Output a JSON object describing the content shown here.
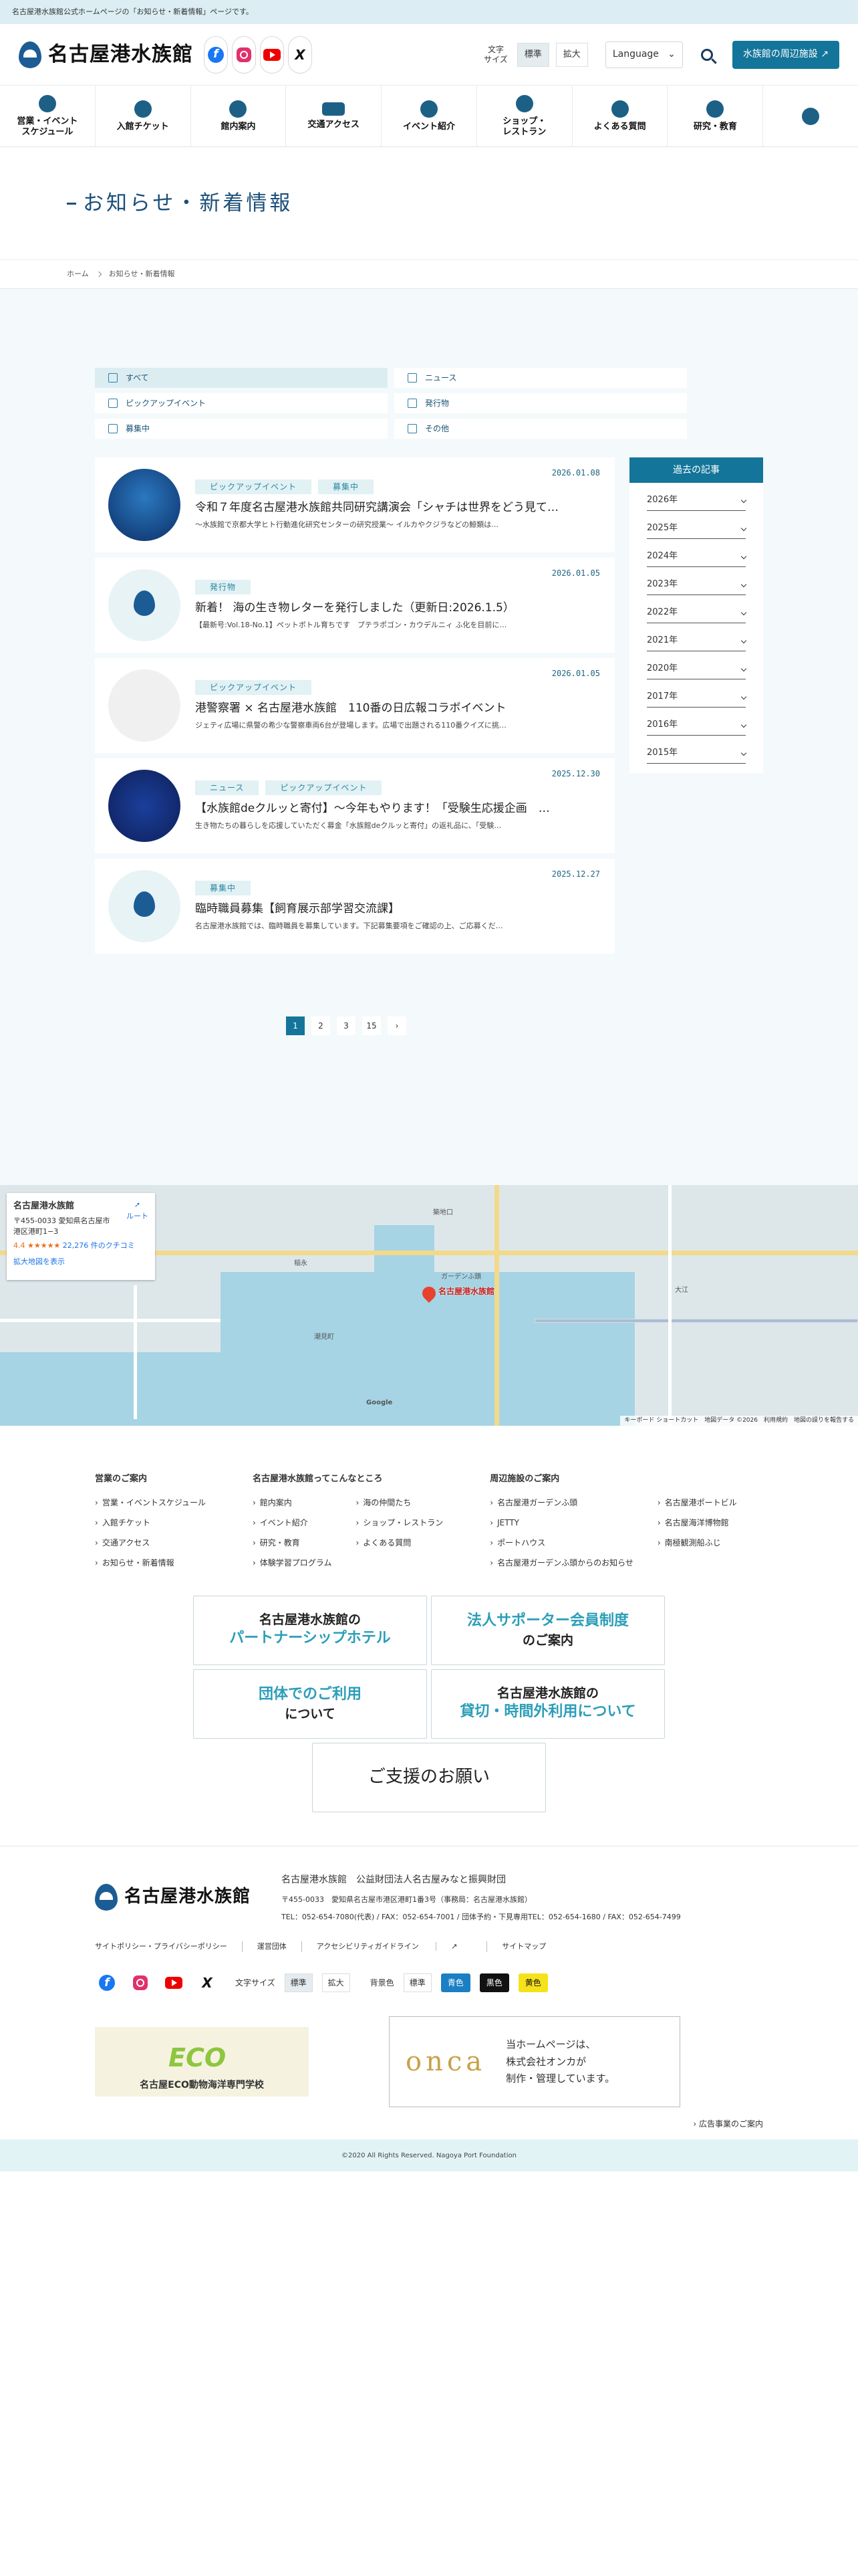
{
  "topbar": {
    "text": "名古屋港水族館公式ホームページの「お知らせ・新着情報」ページです。"
  },
  "header": {
    "logo_text": "名古屋港水族館",
    "font_size_label": "文字\nサイズ",
    "font_size_options": [
      "標準",
      "拡大"
    ],
    "language_label": "Language",
    "nearby_button": "水族館の周辺施設"
  },
  "gnav": [
    {
      "label": "営業・イベント\nスケジュール",
      "icon": "clock-icon"
    },
    {
      "label": "入館チケット",
      "icon": "ticket-icon"
    },
    {
      "label": "館内案内",
      "icon": "map-search-icon"
    },
    {
      "label": "交通アクセス",
      "icon": "bus-icon"
    },
    {
      "label": "イベント紹介",
      "icon": "flag-icon"
    },
    {
      "label": "ショップ・\nレストラン",
      "icon": "shop-icon"
    },
    {
      "label": "よくある質問",
      "icon": "question-icon"
    },
    {
      "label": "研究・教育",
      "icon": "lightbulb-icon"
    },
    {
      "label": "",
      "icon": "gear-icon"
    }
  ],
  "page": {
    "title": "お知らせ・新着情報"
  },
  "breadcrumb": [
    "ホーム",
    "お知らせ・新着情報"
  ],
  "filters": [
    {
      "label": "すべて",
      "icon": "grid-icon"
    },
    {
      "label": "ニュース",
      "icon": "document-icon"
    },
    {
      "label": "ピックアップイベント",
      "icon": "calendar-icon"
    },
    {
      "label": "発行物",
      "icon": "book-icon"
    },
    {
      "label": "募集中",
      "icon": "megaphone-icon"
    },
    {
      "label": "その他",
      "icon": "info-icon"
    }
  ],
  "news": [
    {
      "date": "2026.01.08",
      "tags": [
        "ピックアップイベント",
        "募集中"
      ],
      "title": "令和７年度名古屋港水族館共同研究講演会「シャチは世界をどう見て…",
      "excerpt": "～水族館で京都大学ヒト行動進化研究センターの研究授業～ イルカやクジラなどの鯨類は…"
    },
    {
      "date": "2026.01.05",
      "tags": [
        "発行物"
      ],
      "title": "新着！ 海の生き物レターを発行しました（更新日:2026.1.5）",
      "excerpt": "【最新号:Vol.18-No.1】ペットボトル育ちです　プテラポゴン・カウデルニィ ふ化を目前に…"
    },
    {
      "date": "2026.01.05",
      "tags": [
        "ピックアップイベント"
      ],
      "title": "港警察署 × 名古屋港水族館　110番の日広報コラボイベント",
      "excerpt": "ジェティ広場に県警の希少な警察車両6台が登場します。広場で出題される110番クイズに挑…"
    },
    {
      "date": "2025.12.30",
      "tags": [
        "ニュース",
        "ピックアップイベント"
      ],
      "title": "【水族館deクルッと寄付】～今年もやります！「受験生応援企画　…",
      "excerpt": "生き物たちの暮らしを応援していただく募金「水族館deクルッと寄付」の返礼品に、「受験…"
    },
    {
      "date": "2025.12.27",
      "tags": [
        "募集中"
      ],
      "title": "臨時職員募集【飼育展示部学習交流課】",
      "excerpt": "名古屋港水族館では、臨時職員を募集しています。下記募集要項をご確認の上、ご応募くだ…"
    }
  ],
  "archive": {
    "title": "過去の記事",
    "years": [
      "2026年",
      "2025年",
      "2024年",
      "2023年",
      "2022年",
      "2021年",
      "2020年",
      "2017年",
      "2016年",
      "2015年"
    ]
  },
  "pager": [
    "1",
    "2",
    "3",
    "15",
    "›"
  ],
  "map": {
    "place_name": "名古屋港水族館",
    "address": "〒455-0033 愛知県名古屋市港区港町1−3",
    "rating": "4.4 ★★★★★",
    "reviews": "22,276 件のクチコミ",
    "route_label": "ルート",
    "enlarge_link": "拡大地図を表示",
    "pin_label": "名古屋港水族館",
    "attribution": "キーボード ショートカット　地図データ ©2026　利用規約　地図の誤りを報告する",
    "google": "Google",
    "labels": [
      "築地口",
      "ガーデンふ頭",
      "大江",
      "稲永",
      "潮見町"
    ]
  },
  "footer": {
    "cols": [
      {
        "title": "営業のご案内",
        "items": [
          "営業・イベントスケジュール",
          "入館チケット",
          "交通アクセス",
          "お知らせ・新着情報"
        ]
      },
      {
        "title": "名古屋港水族館ってこんなところ",
        "items": [
          "館内案内",
          "海の仲間たち",
          "イベント紹介",
          "ショップ・レストラン",
          "研究・教育",
          "よくある質問",
          "体験学習プログラム"
        ]
      },
      {
        "title": "周辺施設のご案内",
        "items": [
          "名古屋港ガーデンふ頭",
          "名古屋港ポートビル",
          "JETTY",
          "名古屋海洋博物館",
          "ポートハウス",
          "南極観測船ふじ",
          "名古屋港ガーデンふ頭からのお知らせ"
        ]
      }
    ],
    "banners": [
      {
        "top": "名古屋港水族館の",
        "main": "パートナーシップホテル"
      },
      {
        "top": "法人サポーター会員制度",
        "main": "のご案内"
      },
      {
        "top": "団体でのご利用",
        "main": "について"
      },
      {
        "top": "名古屋港水族館の",
        "main": "貸切・時間外利用について"
      },
      {
        "top": "",
        "main": "ご支援のお願い"
      }
    ],
    "org": "名古屋港水族館　公益財団法人名古屋みなと振興財団",
    "address": "〒455-0033　愛知県名古屋市港区港町1番3号（事務局：名古屋港水族館）",
    "tel": "TEL：052-654-7080(代表) / FAX：052-654-7001 / 団体予約・下見専用TEL：052-654-1680 / FAX：052-654-7499",
    "links": [
      "サイトポリシー・プライバシーポリシー",
      "運営団体",
      "アクセシビリティガイドライン",
      "サイトマップ"
    ],
    "font_size_label": "文字サイズ",
    "font_options": [
      "標準",
      "拡大"
    ],
    "bg_label": "背景色",
    "bg_options": [
      "標準",
      "青色",
      "黒色",
      "黄色"
    ],
    "eco_ad": "名古屋ECO動物海洋専門学校",
    "eco_word": "ECO",
    "onca_logo": "onca",
    "onca_text": "当ホームページは、\n株式会社オンカが\n制作・管理しています。",
    "ad_guide": "広告事業のご案内",
    "copyright": "©2020 All Rights Reserved. Nagoya Port Foundation"
  },
  "colors": {
    "brand": "#14759a",
    "navy": "#1a4f7a",
    "tag_bg": "#e1f1f4"
  }
}
